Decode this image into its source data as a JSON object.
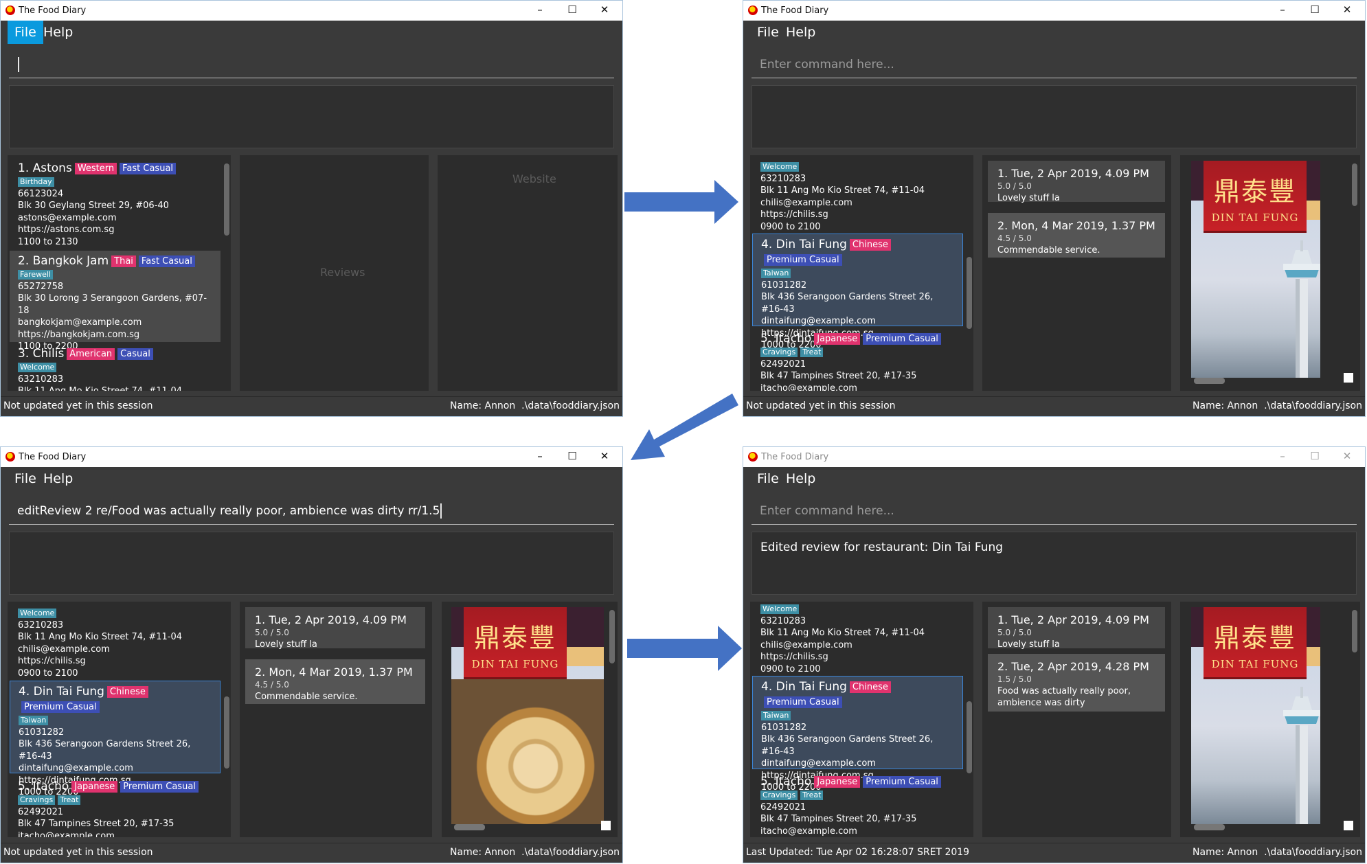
{
  "app_title": "The Food Diary",
  "menu": {
    "file": "File",
    "help": "Help"
  },
  "window_controls": {
    "min": "–",
    "max": "☐",
    "close": "✕"
  },
  "command_placeholder": "Enter command here...",
  "w3_command": "editReview 2 re/Food was actually really poor, ambience was dirty rr/1.5",
  "w4_result": "Edited review for restaurant: Din Tai Fung",
  "placeholders": {
    "reviews": "Reviews",
    "website": "Website"
  },
  "status": {
    "not_updated": "Not updated yet in this session",
    "last_updated": "Last Updated: Tue Apr 02 16:28:07 SRET 2019",
    "user": "Name: Annon",
    "file": ".\\data\\fooddiary.json"
  },
  "restaurants": {
    "astons": {
      "name": "1.  Astons",
      "tags": [
        "Western",
        "Fast Casual"
      ],
      "subtag": "Birthday",
      "phone": "66123024",
      "address": "Blk 30 Geylang Street 29, #06-40",
      "email": "astons@example.com",
      "website": "https://astons.com.sg",
      "hours": "1100 to 2130"
    },
    "bangkok": {
      "name": "2.  Bangkok Jam",
      "tags": [
        "Thai",
        "Fast Casual"
      ],
      "subtag": "Farewell",
      "phone": "65272758",
      "address": "Blk 30 Lorong 3 Serangoon Gardens, #07-18",
      "email": "bangkokjam@example.com",
      "website": "https://bangkokjam.com.sg",
      "hours": "1100 to 2200"
    },
    "chilis": {
      "name": "3.  Chilis",
      "tags": [
        "American",
        "Casual"
      ],
      "subtag": "Welcome",
      "phone": "63210283",
      "address": "Blk 11 Ang Mo Kio Street 74, #11-04",
      "email": "chilis@example.com",
      "website": "https://chilis.sg",
      "hours": "0900 to 2100"
    },
    "dtf": {
      "name": "4.  Din Tai Fung",
      "tags": [
        "Chinese",
        "Premium Casual"
      ],
      "subtag": "Taiwan",
      "phone": "61031282",
      "address": "Blk 436 Serangoon Gardens Street 26, #16-43",
      "email": "dintaifung@example.com",
      "website": "https://dintaifung.com.sg",
      "hours": "1000 to 2200"
    },
    "itacho": {
      "name": "5.  Itacho",
      "tags": [
        "Japanese",
        "Premium Casual"
      ],
      "subtags": [
        "Cravings",
        "Treat"
      ],
      "phone": "62492021",
      "address": "Blk 47 Tampines Street 20, #17-35",
      "email": "itacho@example.com"
    }
  },
  "reviews": {
    "r1": {
      "title": "1.  Tue, 2 Apr 2019, 4.09 PM",
      "rating": "5.0 / 5.0",
      "text": "Lovely stuff la"
    },
    "r2": {
      "title": "2.  Mon, 4 Mar 2019, 1.37 PM",
      "rating": "4.5 / 5.0",
      "text": "Commendable service."
    },
    "r2_edited": {
      "title": "2.  Tue, 2 Apr 2019, 4.28 PM",
      "rating": "1.5 / 5.0",
      "text": "Food was actually really poor, ambience was dirty"
    }
  },
  "banner": {
    "chinese": "鼎泰豐",
    "english": "DIN TAI FUNG"
  },
  "colors": {
    "accent": "#0a9ade",
    "cuisine_tag": "#e0336e",
    "price_tag": "#3d4fb5",
    "misc_tag": "#3e8fa5",
    "arrow": "#4472c4"
  }
}
